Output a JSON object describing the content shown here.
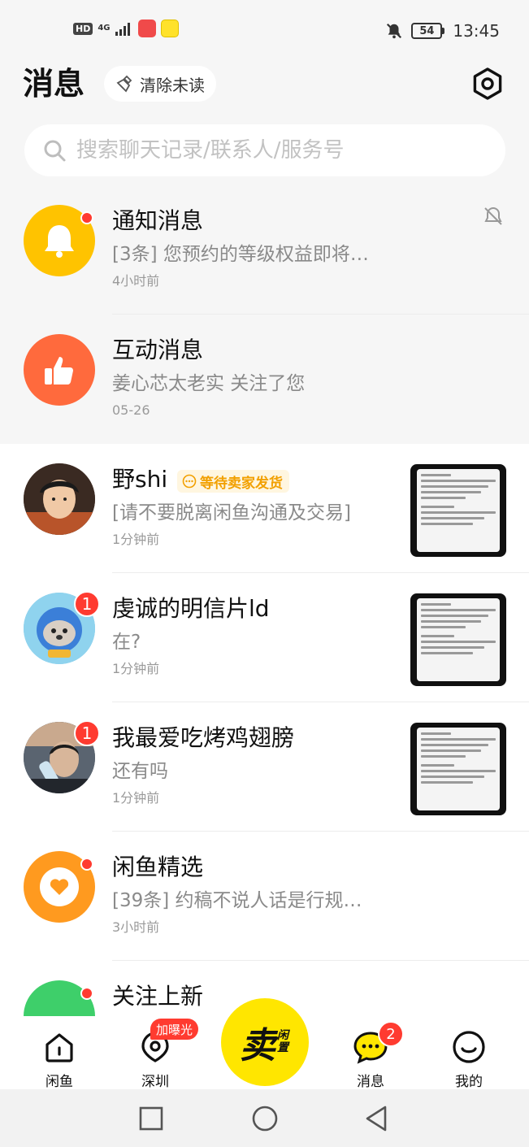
{
  "status_bar": {
    "hd": "HD",
    "network": "4G",
    "battery": "54",
    "time": "13:45"
  },
  "header": {
    "title": "消息",
    "clear_unread_label": "清除未读"
  },
  "search": {
    "placeholder": "搜索聊天记录/联系人/服务号"
  },
  "system_rows": [
    {
      "title": "通知消息",
      "preview": "[3条] 您预约的等级权益即将…",
      "time": "4小时前"
    },
    {
      "title": "互动消息",
      "preview": "姜心芯太老实 关注了您",
      "time": "05-26"
    }
  ],
  "chat_rows": [
    {
      "name": "野shi",
      "tag": "等待卖家发货",
      "preview": "[请不要脱离闲鱼沟通及交易]",
      "time": "1分钟前"
    },
    {
      "name": "虔诚的明信片ld",
      "badge": "1",
      "preview": "在?",
      "time": "1分钟前"
    },
    {
      "name": "我最爱吃烤鸡翅膀",
      "badge": "1",
      "preview": "还有吗",
      "time": "1分钟前"
    },
    {
      "name": "闲鱼精选",
      "preview": "[39条] 约稿不说人话是行规…",
      "time": "3小时前"
    },
    {
      "name": "关注上新"
    }
  ],
  "bottom_nav": {
    "home": "闲鱼",
    "city": "深圳",
    "city_tag": "加曝光",
    "sell_main": "卖",
    "sell_sub": "闲置",
    "messages": "消息",
    "messages_badge": "2",
    "mine": "我的"
  },
  "colors": {
    "accent_yellow": "#ffe600",
    "badge_red": "#ff3b30",
    "notify_orange": "#ffc300",
    "interact_red": "#ff6a3d"
  }
}
